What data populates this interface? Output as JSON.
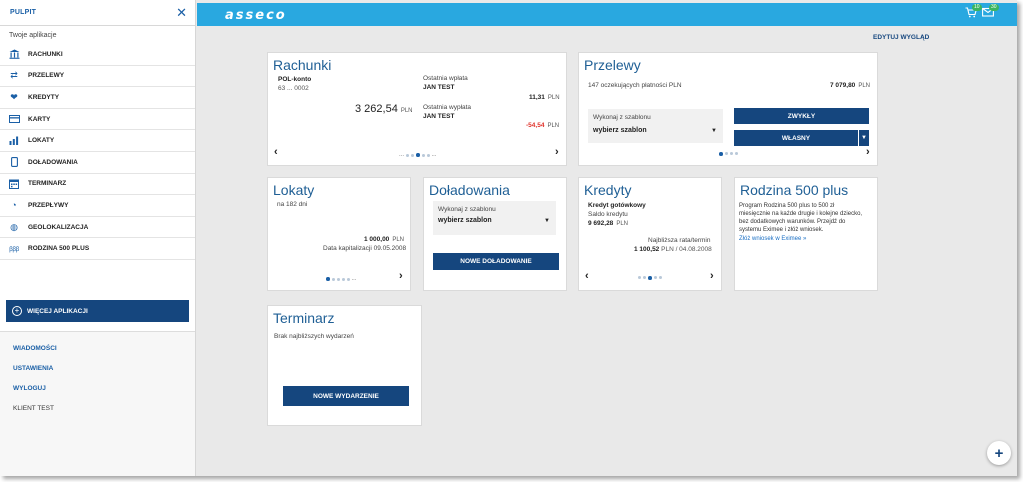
{
  "sidebar": {
    "title": "PULPIT",
    "subtitle": "Twoje aplikacje",
    "items": [
      {
        "label": "RACHUNKI",
        "icon": "bank-icon"
      },
      {
        "label": "PRZELEWY",
        "icon": "transfer-icon"
      },
      {
        "label": "KREDYTY",
        "icon": "handshake-icon"
      },
      {
        "label": "KARTY",
        "icon": "card-icon"
      },
      {
        "label": "LOKATY",
        "icon": "chart-icon"
      },
      {
        "label": "DOŁADOWANIA",
        "icon": "phone-icon"
      },
      {
        "label": "TERMINARZ",
        "icon": "calendar-icon"
      },
      {
        "label": "PRZEPŁYWY",
        "icon": "cashflow-icon"
      },
      {
        "label": "GEOLOKALIZACJA",
        "icon": "globe-icon"
      },
      {
        "label": "RODZINA 500 PLUS",
        "icon": "family-icon"
      }
    ],
    "more_label": "WIĘCEJ APLIKACJI",
    "links": [
      "WIADOMOŚCI",
      "USTAWIENIA",
      "WYLOGUJ"
    ],
    "user": "KLIENT TEST"
  },
  "topbar": {
    "logo": "asseco",
    "cart_badge": "10",
    "mail_badge": "30"
  },
  "edit_view": "EDYTUJ WYGLĄD",
  "rachunki": {
    "title": "Rachunki",
    "account_name": "POL-konto",
    "account_number": "63 ... 0002",
    "balance": "3 262,54",
    "currency": "PLN",
    "last_in_label": "Ostatnia wpłata",
    "last_in_name": "JAN TEST",
    "last_in_amount": "11,31",
    "last_out_label": "Ostatnia wypłata",
    "last_out_name": "JAN TEST",
    "last_out_amount": "-54,54",
    "ellipsis_left": "...",
    "ellipsis_right": "..."
  },
  "przelewy": {
    "title": "Przelewy",
    "pending": "147 oczekujących płatności PLN",
    "pending_amount": "7 079,80",
    "currency": "PLN",
    "template_label": "Wykonaj z szablonu",
    "template_value": "wybierz szablon",
    "btn_regular": "ZWYKŁY",
    "btn_own": "WŁASNY"
  },
  "lokaty": {
    "title": "Lokaty",
    "period": "na 182 dni",
    "amount": "1 000,00",
    "currency": "PLN",
    "cap_date": "Data kapitalizacji 09.05.2008",
    "ellipsis": "..."
  },
  "doladowania": {
    "title": "Doładowania",
    "template_label": "Wykonaj z szablonu",
    "template_value": "wybierz szablon",
    "btn_new": "NOWE DOŁADOWANIE"
  },
  "kredyty": {
    "title": "Kredyty",
    "name": "Kredyt gotówkowy",
    "balance_label": "Saldo kredytu",
    "balance": "9 692,28",
    "currency": "PLN",
    "next_label": "Najbliższa rata/termin",
    "next_amount": "1 100,52",
    "next_date": "PLN / 04.08.2008"
  },
  "rodzina": {
    "title": "Rodzina 500 plus",
    "line1": "Program Rodzina 500 plus to 500 zł",
    "line2": "miesięcznie na każde drugie i kolejne dziecko,",
    "line3": "bez dodatkowych warunków. Przejdź do",
    "line4": "systemu Eximee i złóż wniosek.",
    "link": "Złóż wniosek w Eximee »"
  },
  "terminarz": {
    "title": "Terminarz",
    "empty": "Brak najbliższych wydarzeń",
    "btn_new": "NOWE WYDARZENIE"
  }
}
